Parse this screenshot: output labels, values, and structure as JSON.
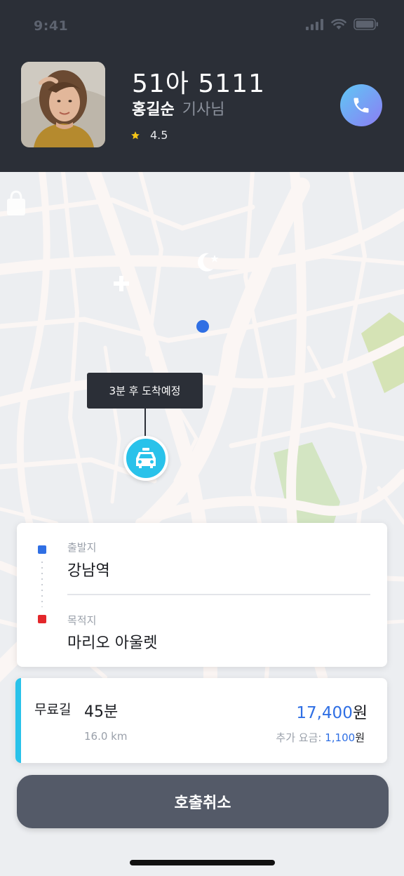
{
  "status_bar": {
    "time": "9:41"
  },
  "driver": {
    "plate": "51아 5111",
    "name": "홍길순",
    "title": "기사님",
    "rating": "4.5"
  },
  "map": {
    "eta_text": "3분 후 도착예정"
  },
  "route": {
    "origin_label": "출발지",
    "origin_value": "강남역",
    "destination_label": "목적지",
    "destination_value": "마리오 아울렛"
  },
  "fare": {
    "type": "무료길",
    "time": "45분",
    "distance": "16.0 km",
    "price": "17,400",
    "price_unit": "원",
    "extra_label": "추가 요금:",
    "extra_value": "1,100",
    "extra_unit": "원"
  },
  "actions": {
    "cancel_label": "호출취소"
  },
  "colors": {
    "header_bg": "#2b2f37",
    "accent_blue": "#2f6fe4",
    "accent_cyan": "#29c2ea",
    "destination_red": "#e3272b",
    "cancel_bg": "#545a68"
  },
  "icons": [
    "phone-icon",
    "star-icon",
    "taxi-icon",
    "signal-icon",
    "wifi-icon",
    "battery-icon"
  ]
}
